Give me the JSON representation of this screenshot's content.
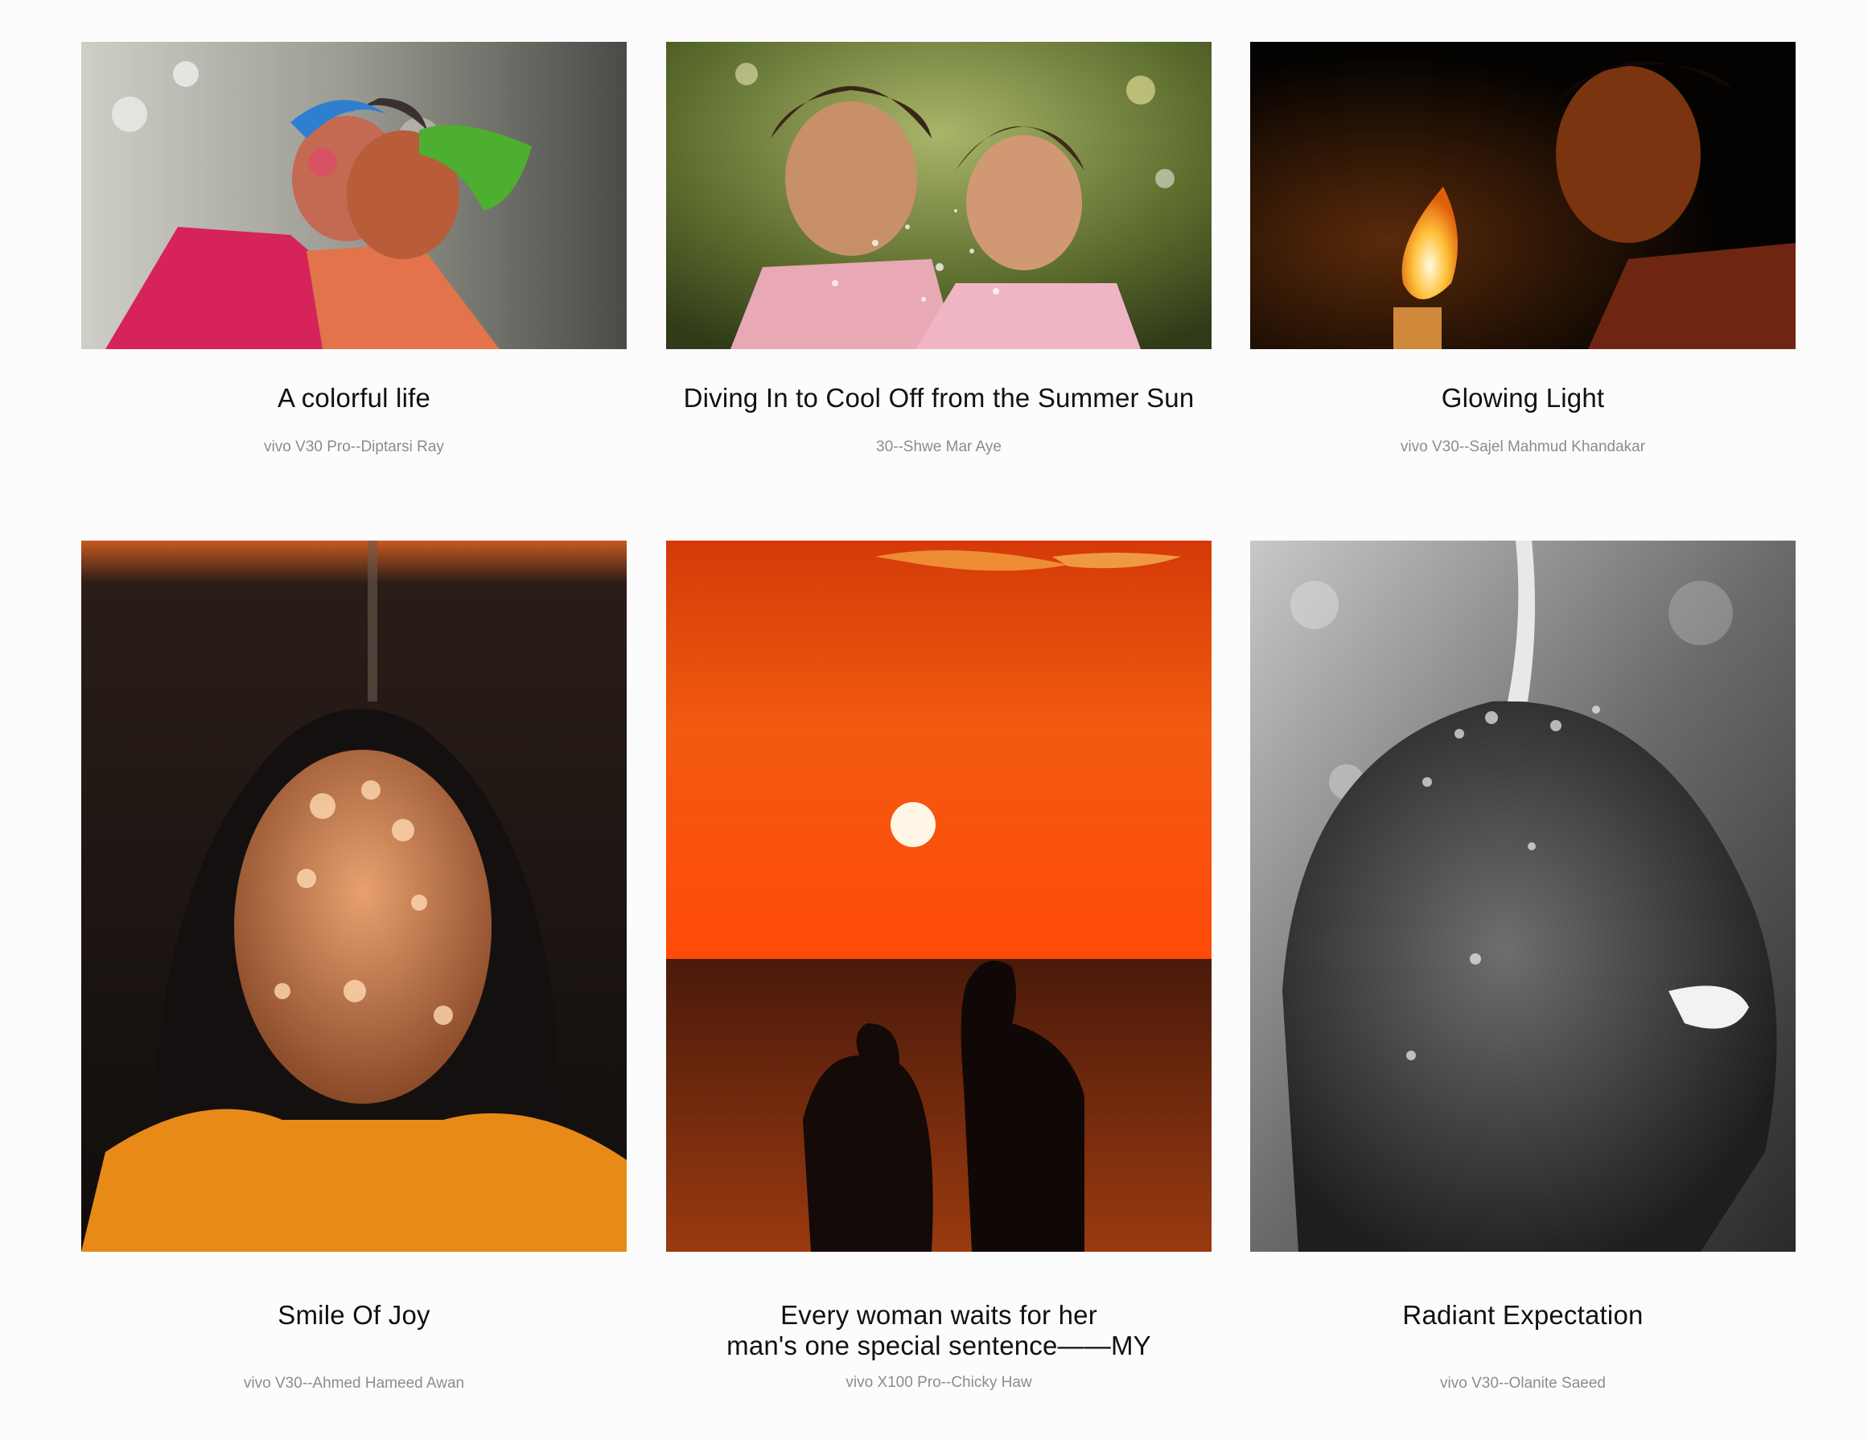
{
  "gallery": {
    "items": [
      {
        "title": "A colorful life",
        "credit": "vivo V30 Pro--Diptarsi Ray",
        "icon": "photo-holi-embrace"
      },
      {
        "title": "Diving In to Cool Off from the Summer Sun",
        "credit": "30--Shwe Mar Aye",
        "icon": "photo-girls-water-splash"
      },
      {
        "title": "Glowing Light",
        "credit": "vivo V30--Sajel Mahmud Khandakar",
        "icon": "photo-child-candle"
      },
      {
        "title": "Smile Of Joy",
        "credit": "vivo V30--Ahmed Hameed Awan",
        "icon": "photo-girl-dappled-light"
      },
      {
        "title": "Every woman waits for her\nman's one special sentence——MY",
        "credit": "vivo X100 Pro--Chicky Haw",
        "icon": "photo-sunset-couple"
      },
      {
        "title": "Radiant Expectation",
        "credit": "vivo V30--Olanite Saeed",
        "icon": "photo-man-water-bw"
      }
    ]
  }
}
